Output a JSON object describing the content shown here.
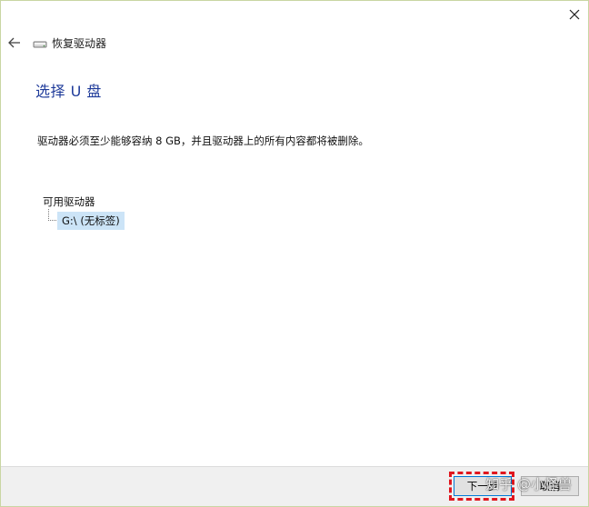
{
  "window": {
    "header_title": "恢复驱动器",
    "drive_icon": "drive-icon",
    "back_icon": "back-arrow-icon",
    "close_icon": "close-icon"
  },
  "main": {
    "title": "选择 U 盘",
    "description": "驱动器必须至少能够容纳 8 GB，并且驱动器上的所有内容都将被删除。",
    "drives_label": "可用驱动器",
    "drives": [
      {
        "label": "G:\\ (无标签)",
        "selected": true
      }
    ]
  },
  "footer": {
    "next_label": "下一步",
    "cancel_label": "取消"
  },
  "watermark": "知乎 @小怪兽",
  "colors": {
    "title_blue": "#1f3b9a",
    "selection_blue": "#cce4f7",
    "highlight_red": "#e0161e"
  }
}
